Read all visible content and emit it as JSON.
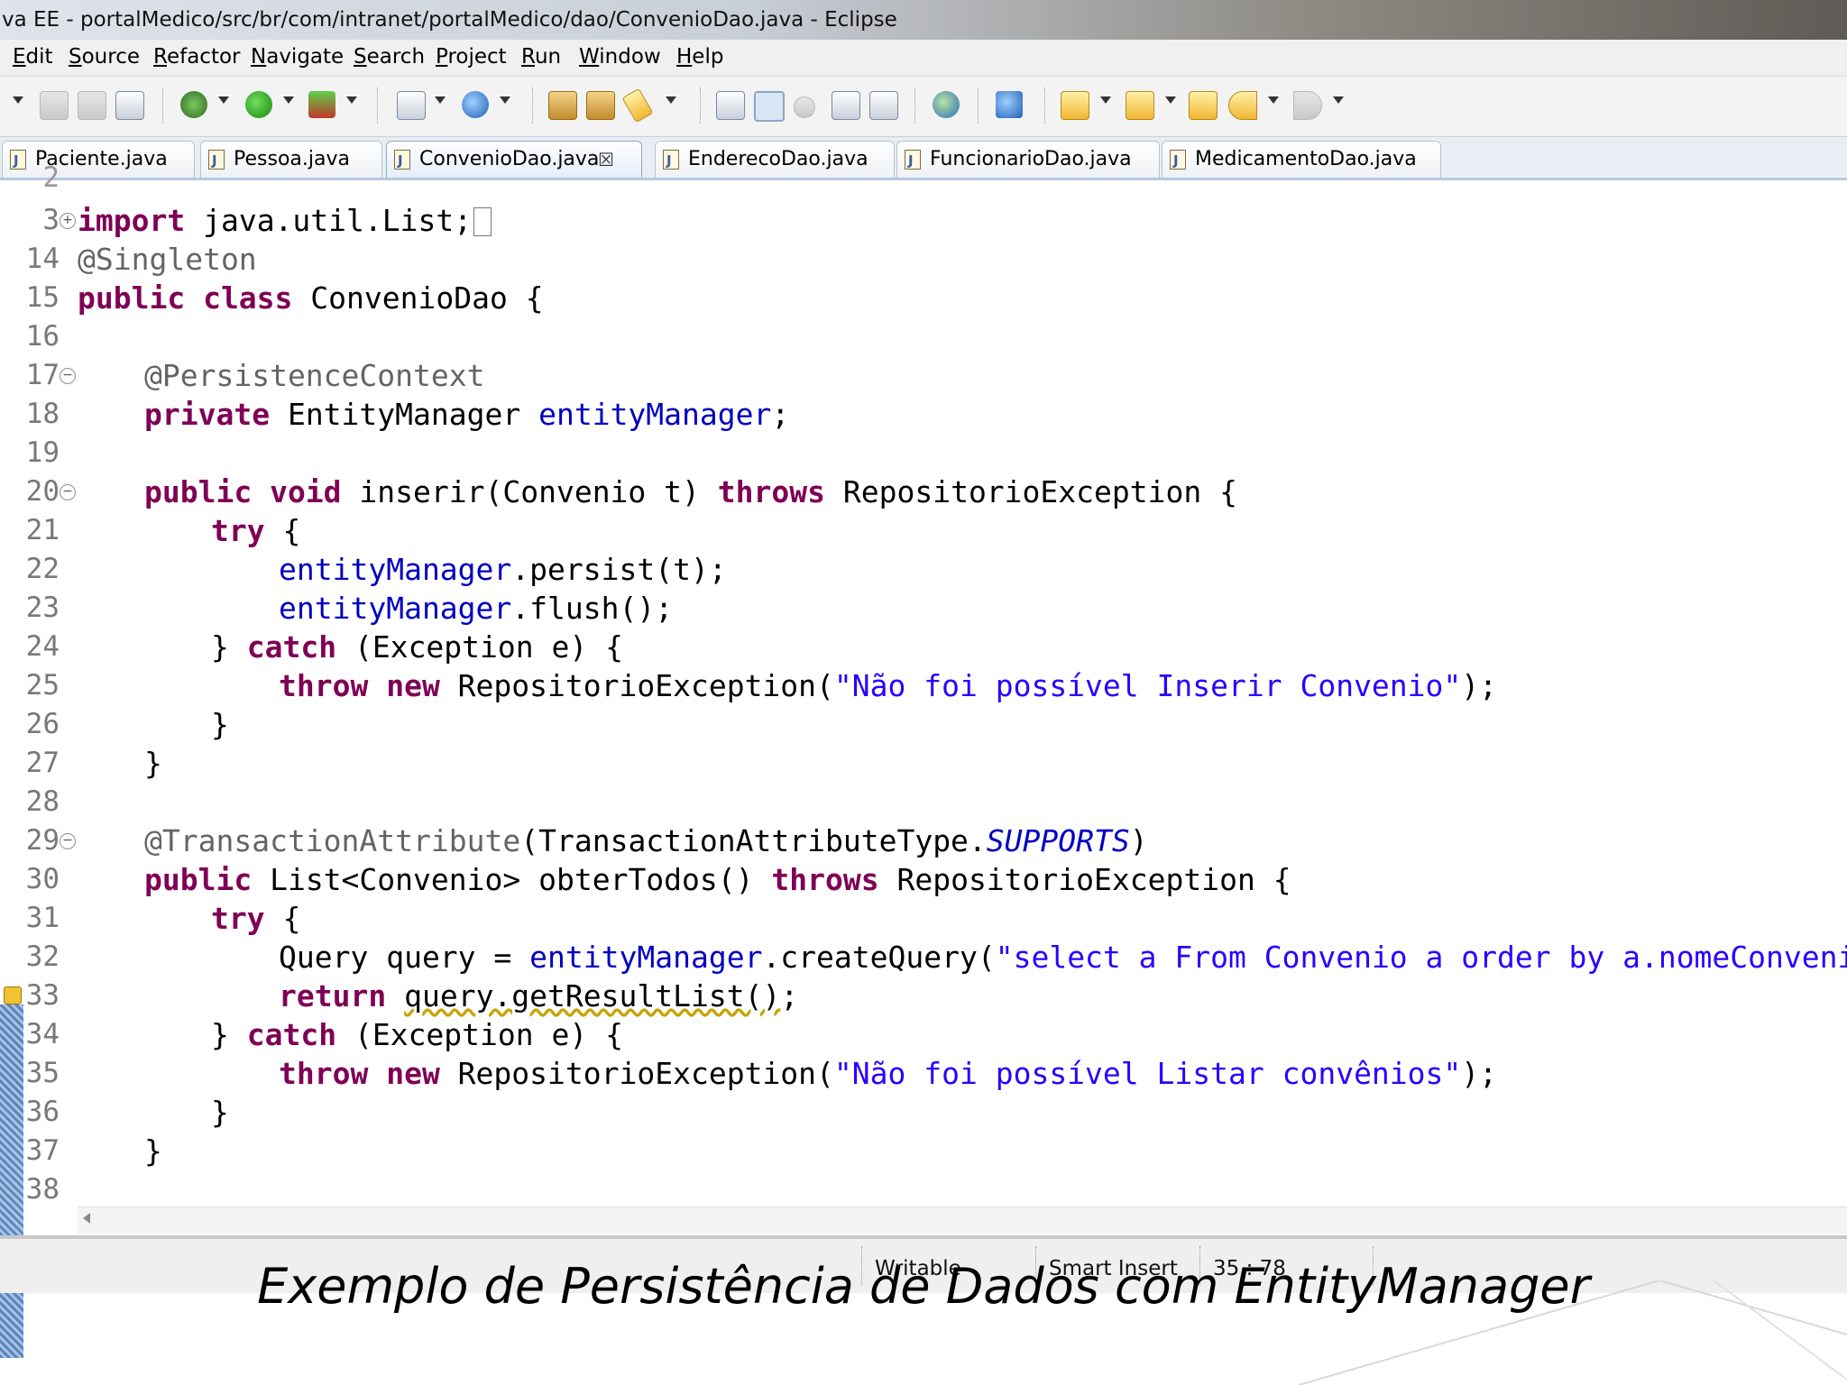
{
  "window": {
    "title": "va EE - portalMedico/src/br/com/intranet/portalMedico/dao/ConvenioDao.java - Eclipse"
  },
  "menu": [
    "Edit",
    "Source",
    "Refactor",
    "Navigate",
    "Search",
    "Project",
    "Run",
    "Window",
    "Help"
  ],
  "toolbar_icons": [
    "dropdown-arrow-icon",
    "save-icon",
    "save-all-icon",
    "print-icon",
    "debug-icon",
    "run-icon",
    "external-tools-icon",
    "new-java-project-icon",
    "new-class-icon",
    "open-type-icon",
    "open-folder-icon",
    "search-icon",
    "toggle-breadcrumb-icon",
    "mark-occurrences-icon",
    "toggle-block-selection-icon",
    "show-whitespace-icon",
    "globe-icon",
    "open-task-icon",
    "next-annotation-icon",
    "previous-annotation-icon",
    "last-edit-location-icon",
    "back-icon",
    "forward-icon"
  ],
  "tabs": [
    {
      "label": "Paciente.java",
      "active": false
    },
    {
      "label": "Pessoa.java",
      "active": false
    },
    {
      "label": "ConvenioDao.java",
      "active": true,
      "close": "☒"
    },
    {
      "label": "EnderecoDao.java",
      "active": false
    },
    {
      "label": "FuncionarioDao.java",
      "active": false
    },
    {
      "label": "MedicamentoDao.java",
      "active": false
    }
  ],
  "line_numbers": [
    "2",
    "3",
    "14",
    "15",
    "16",
    "17",
    "18",
    "19",
    "20",
    "21",
    "22",
    "23",
    "24",
    "25",
    "26",
    "27",
    "28",
    "29",
    "30",
    "31",
    "32",
    "33",
    "34",
    "35",
    "36",
    "37",
    "38"
  ],
  "code": {
    "l3_import": "import",
    "l3_rest": " java.util.List;",
    "l14": "@Singleton",
    "l15_kw": "public class",
    "l15_rest": " ConvenioDao {",
    "l17": "@PersistenceContext",
    "l18_kw": "private",
    "l18_type": " EntityManager ",
    "l18_field": "entityManager",
    "l18_end": ";",
    "l20_kw": "public void",
    "l20_mid": " inserir(Convenio t) ",
    "l20_throws": "throws",
    "l20_end": " RepositorioException {",
    "l21_kw": "try",
    "l21_end": " {",
    "l22_field": "entityManager",
    "l22_end": ".persist(t);",
    "l23_field": "entityManager",
    "l23_end": ".flush();",
    "l24_start": "} ",
    "l24_kw": "catch",
    "l24_end": " (Exception e) {",
    "l25_kw": "throw new",
    "l25_mid": " RepositorioException(",
    "l25_str": "\"Não foi possível Inserir Convenio\"",
    "l25_end": ");",
    "l26": "}",
    "l27": "}",
    "l29_ann": "@TransactionAttribute",
    "l29_mid": "(TransactionAttributeType.",
    "l29_const": "SUPPORTS",
    "l29_end": ")",
    "l30_kw": "public",
    "l30_mid": " List<Convenio> obterTodos() ",
    "l30_throws": "throws",
    "l30_end": " RepositorioException {",
    "l31_kw": "try",
    "l31_end": " {",
    "l32_start": "Query query = ",
    "l32_field": "entityManager",
    "l32_mid": ".createQuery(",
    "l32_str": "\"select a From Convenio a order by a.nomeConvenio\"",
    "l32_end": ");",
    "l33_kw": "return",
    "l33_sq": "query.getResultList()",
    "l33_end": ";",
    "l34_start": "} ",
    "l34_kw": "catch",
    "l34_end": " (Exception e) {",
    "l35_kw": "throw new",
    "l35_mid": " RepositorioException(",
    "l35_str": "\"Não foi possível Listar convênios\"",
    "l35_end": ");",
    "l36": "}",
    "l37": "}"
  },
  "status": {
    "writable": "Writable",
    "insert_mode": "Smart Insert",
    "position": "35 : 78"
  },
  "caption": "Exemplo de Persistência de Dados com EntityManager"
}
